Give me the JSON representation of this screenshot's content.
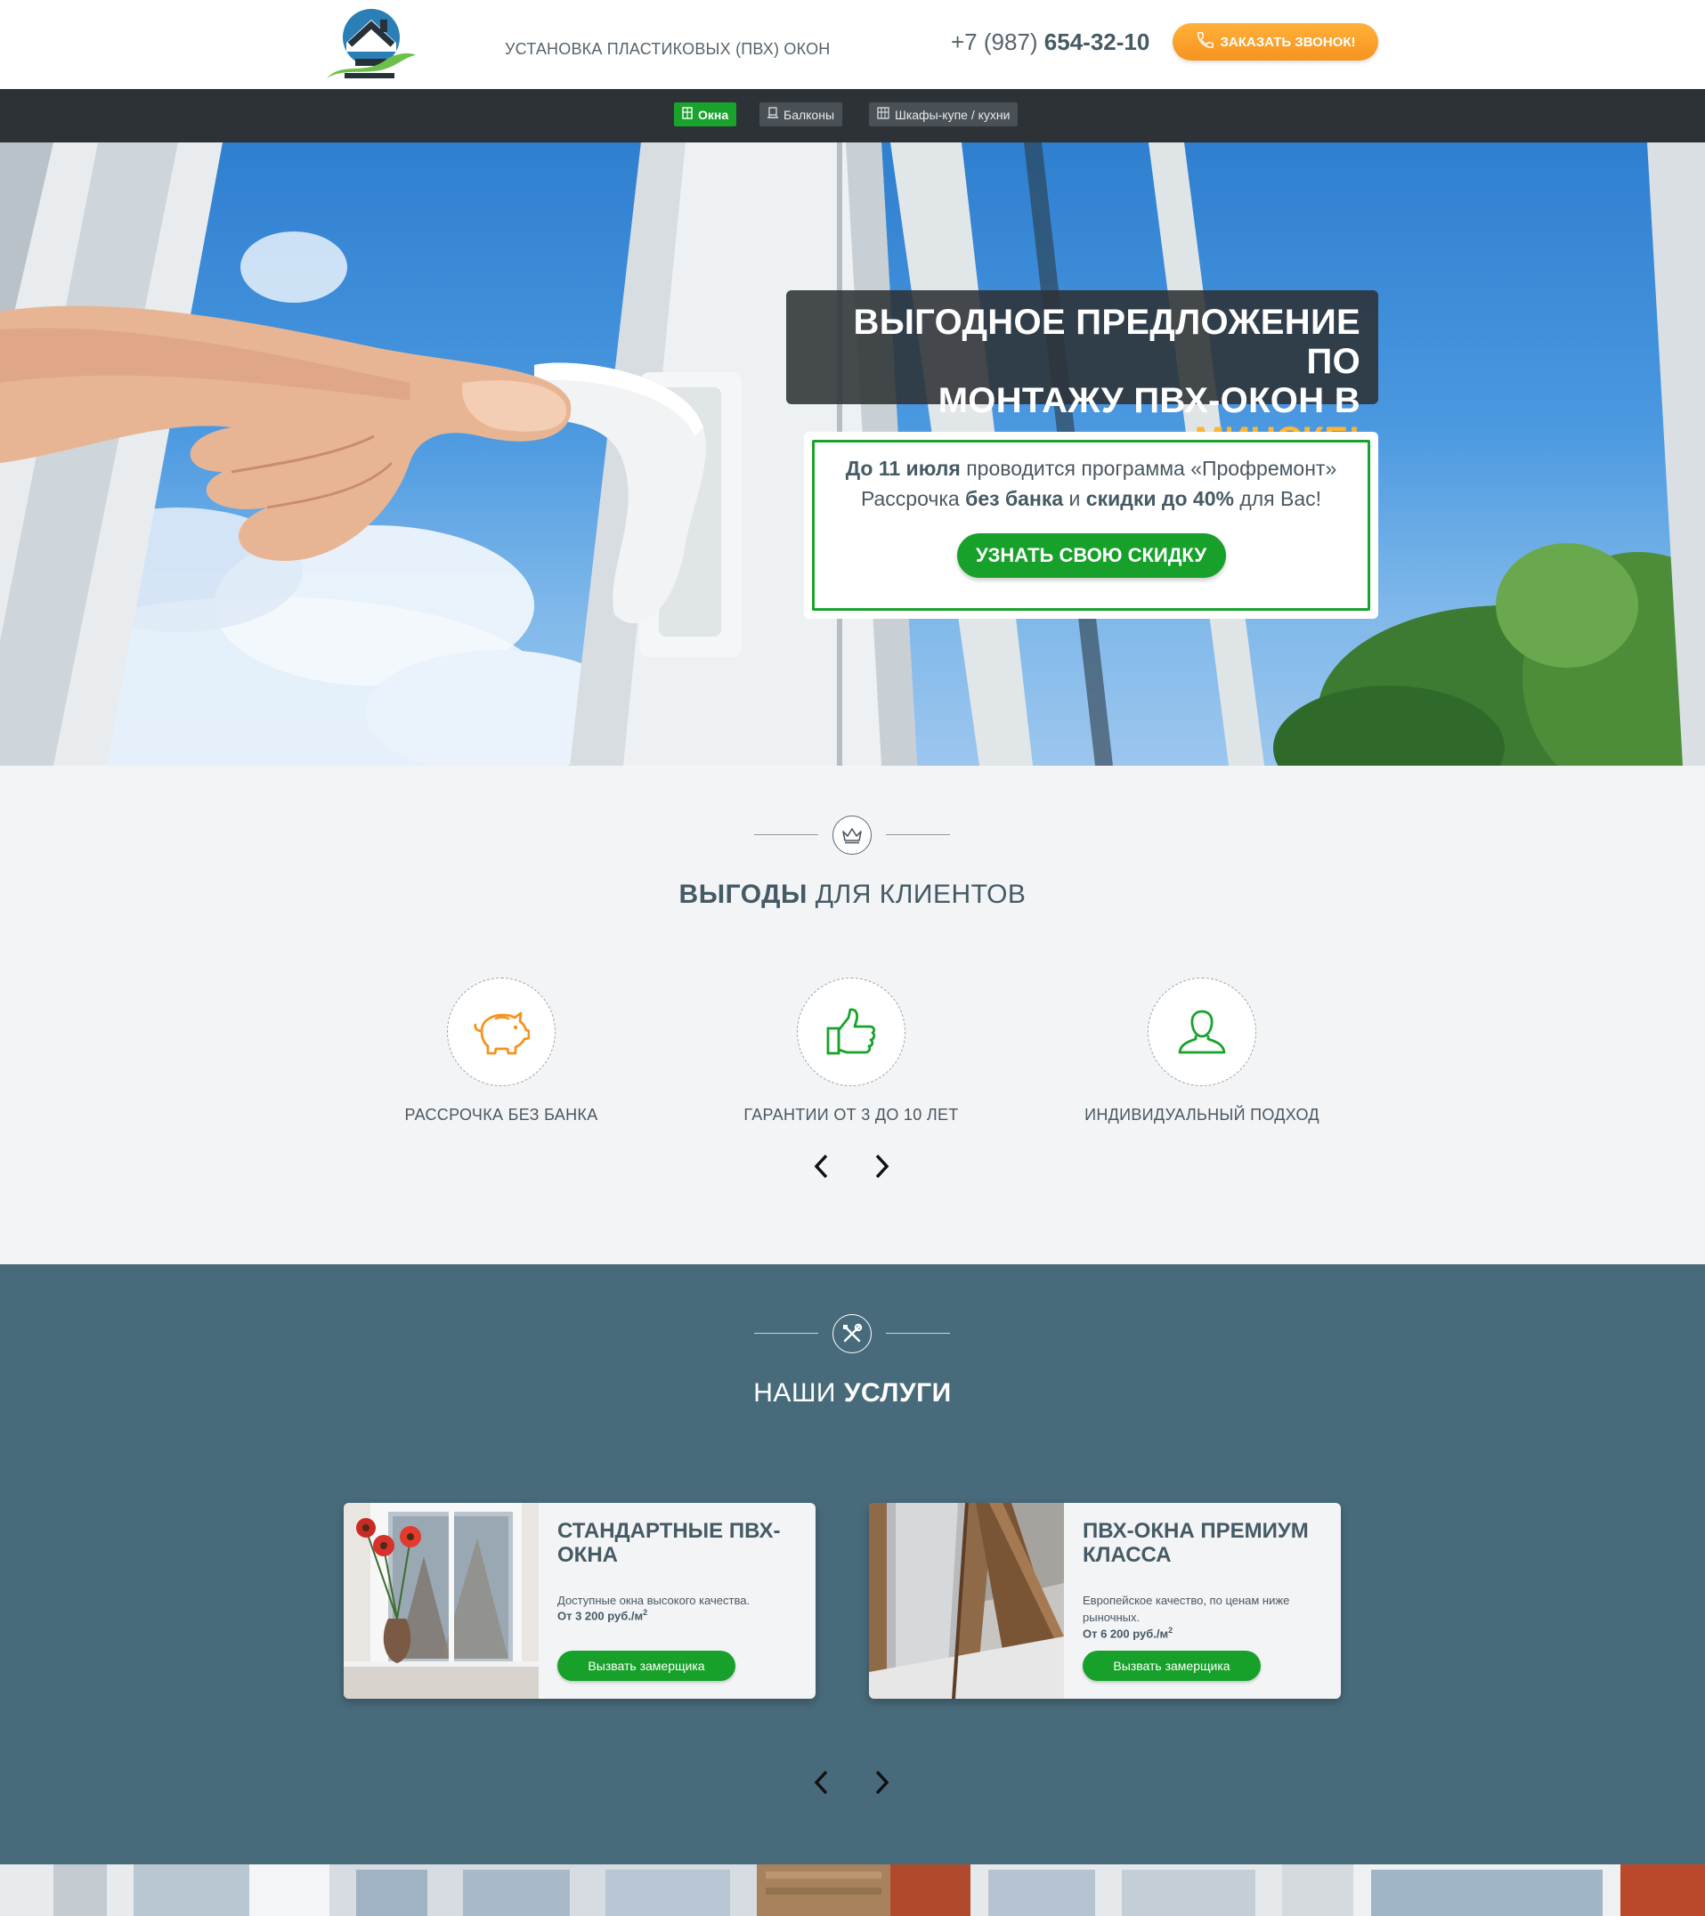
{
  "header": {
    "tagline": "УСТАНОВКА ПЛАСТИКОВЫХ (ПВХ) ОКОН",
    "phone_prefix": "+7 (987) ",
    "phone_main": "654-32-10",
    "call_button": "ЗАКАЗАТЬ ЗВОНОК!"
  },
  "nav": {
    "items": [
      {
        "label": "Окна",
        "icon": "window-icon",
        "active": true
      },
      {
        "label": "Балконы",
        "icon": "balcony-icon",
        "active": false
      },
      {
        "label": "Шкафы-купе / кухни",
        "icon": "wardrobe-icon",
        "active": false
      }
    ]
  },
  "hero": {
    "title_part1": "ВЫГОДНОЕ ПРЕДЛОЖЕНИЕ ПО",
    "title_part2": "МОНТАЖУ ПВХ-ОКОН В ",
    "title_accent": "МИНСКЕ!",
    "offer": {
      "line1_bold": "До 11 июля",
      "line1_rest": " проводится программа «Профремонт»",
      "line2_a": "Рассрочка ",
      "line2_b": "без банка",
      "line2_c": " и ",
      "line2_d": "скидки до 40%",
      "line2_e": " для Вас!"
    },
    "cta": "УЗНАТЬ СВОЮ СКИДКУ"
  },
  "benefits": {
    "icon": "crown-icon",
    "title_bold": "ВЫГОДЫ",
    "title_rest": " ДЛЯ КЛИЕНТОВ",
    "items": [
      {
        "label": "РАССРОЧКА БЕЗ БАНКА",
        "icon": "piggy-bank-icon"
      },
      {
        "label": "ГАРАНТИИ ОТ 3 ДО 10 ЛЕТ",
        "icon": "thumbs-up-icon"
      },
      {
        "label": "ИНДИВИДУАЛЬНЫЙ ПОДХОД",
        "icon": "user-icon"
      }
    ]
  },
  "services": {
    "icon": "tools-icon",
    "title_rest": "НАШИ ",
    "title_bold": "УСЛУГИ",
    "cards": [
      {
        "title": "СТАНДАРТНЫЕ ПВХ-ОКНА",
        "desc": "Доступные окна высокого качества.",
        "price": "От 3 200 руб./м",
        "button": "Вызвать замерщика"
      },
      {
        "title": "ПВХ-ОКНА ПРЕМИУМ КЛАССА",
        "desc": "Европейское качество, по ценам ниже рыночных.",
        "price": "От 6 200 руб./м",
        "button": "Вызвать замерщика"
      }
    ]
  },
  "colors": {
    "green": "#19a22c",
    "orange": "#f6931e",
    "accent_yellow": "#ffb62f",
    "dark_nav": "#2c3236",
    "services_bg": "#486b7b",
    "text": "#455a64"
  }
}
